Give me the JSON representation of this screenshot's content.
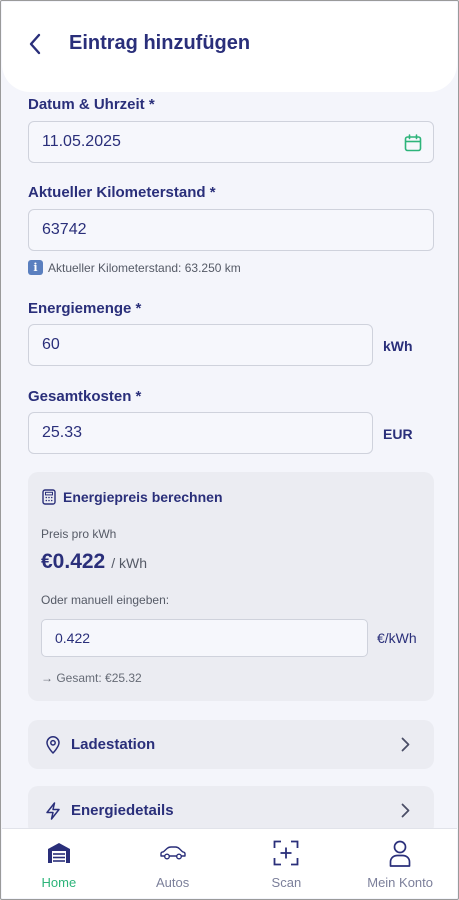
{
  "header": {
    "title": "Eintrag hinzufügen"
  },
  "form": {
    "datetime": {
      "label": "Datum & Uhrzeit *",
      "value": "11.05.2025"
    },
    "odometer": {
      "label": "Aktueller Kilometerstand *",
      "value": "63742",
      "hint": "Aktueller Kilometerstand: 63.250 km"
    },
    "energy": {
      "label": "Energiemenge *",
      "value": "60",
      "unit": "kWh"
    },
    "cost": {
      "label": "Gesamtkosten *",
      "value": "25.33",
      "unit": "EUR"
    }
  },
  "price_calc": {
    "title": "Energiepreis berechnen",
    "price_label": "Preis pro kWh",
    "price_value": "€0.422",
    "price_unit": "/ kWh",
    "manual_label": "Oder manuell eingeben:",
    "manual_value": "0.422",
    "manual_unit": "€/kWh",
    "total": "→ Gesamt: €25.32"
  },
  "sections": {
    "station": "Ladestation",
    "energy_details": "Energiedetails"
  },
  "nav": {
    "home": "Home",
    "cars": "Autos",
    "scan": "Scan",
    "account": "Mein Konto"
  },
  "colors": {
    "primary": "#2a2f7a",
    "accent": "#2db47a",
    "background": "#f4f5fb"
  }
}
